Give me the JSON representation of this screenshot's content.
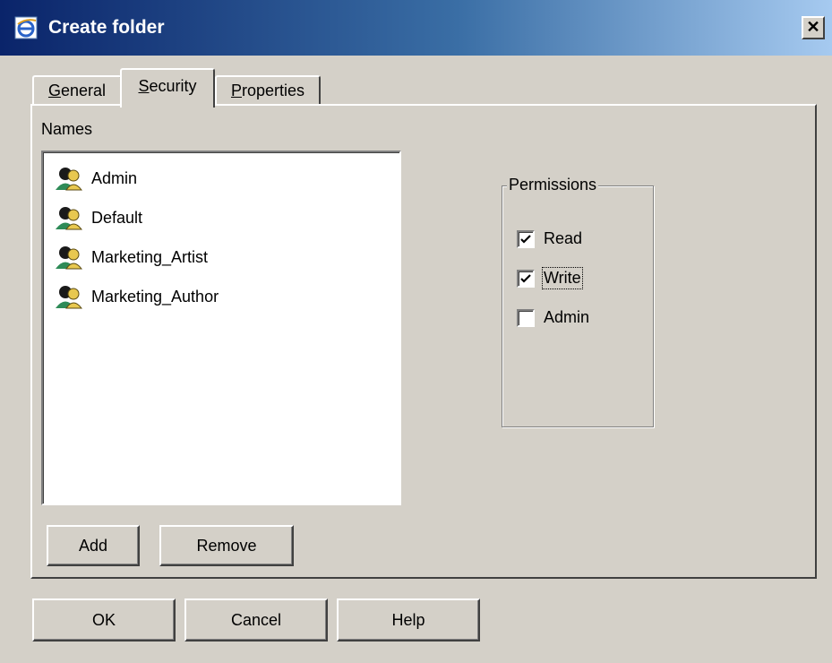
{
  "window": {
    "title": "Create folder",
    "close_label": "✕"
  },
  "tabs": [
    {
      "label": "General",
      "mnemonic": "G",
      "rest": "eneral"
    },
    {
      "label": "Security",
      "mnemonic": "S",
      "rest": "ecurity"
    },
    {
      "label": "Properties",
      "mnemonic": "P",
      "rest": "roperties"
    }
  ],
  "active_tab": "Security",
  "names": {
    "label": "Names",
    "items": [
      "Admin",
      "Default",
      "Marketing_Artist",
      "Marketing_Author"
    ]
  },
  "permissions": {
    "legend": "Permissions",
    "options": [
      {
        "label": "Read",
        "checked": true
      },
      {
        "label": "Write",
        "checked": true
      },
      {
        "label": "Admin",
        "checked": false
      }
    ]
  },
  "panel_buttons": {
    "add": "Add",
    "remove": "Remove"
  },
  "dialog_buttons": {
    "ok": "OK",
    "cancel": "Cancel",
    "help": "Help"
  }
}
